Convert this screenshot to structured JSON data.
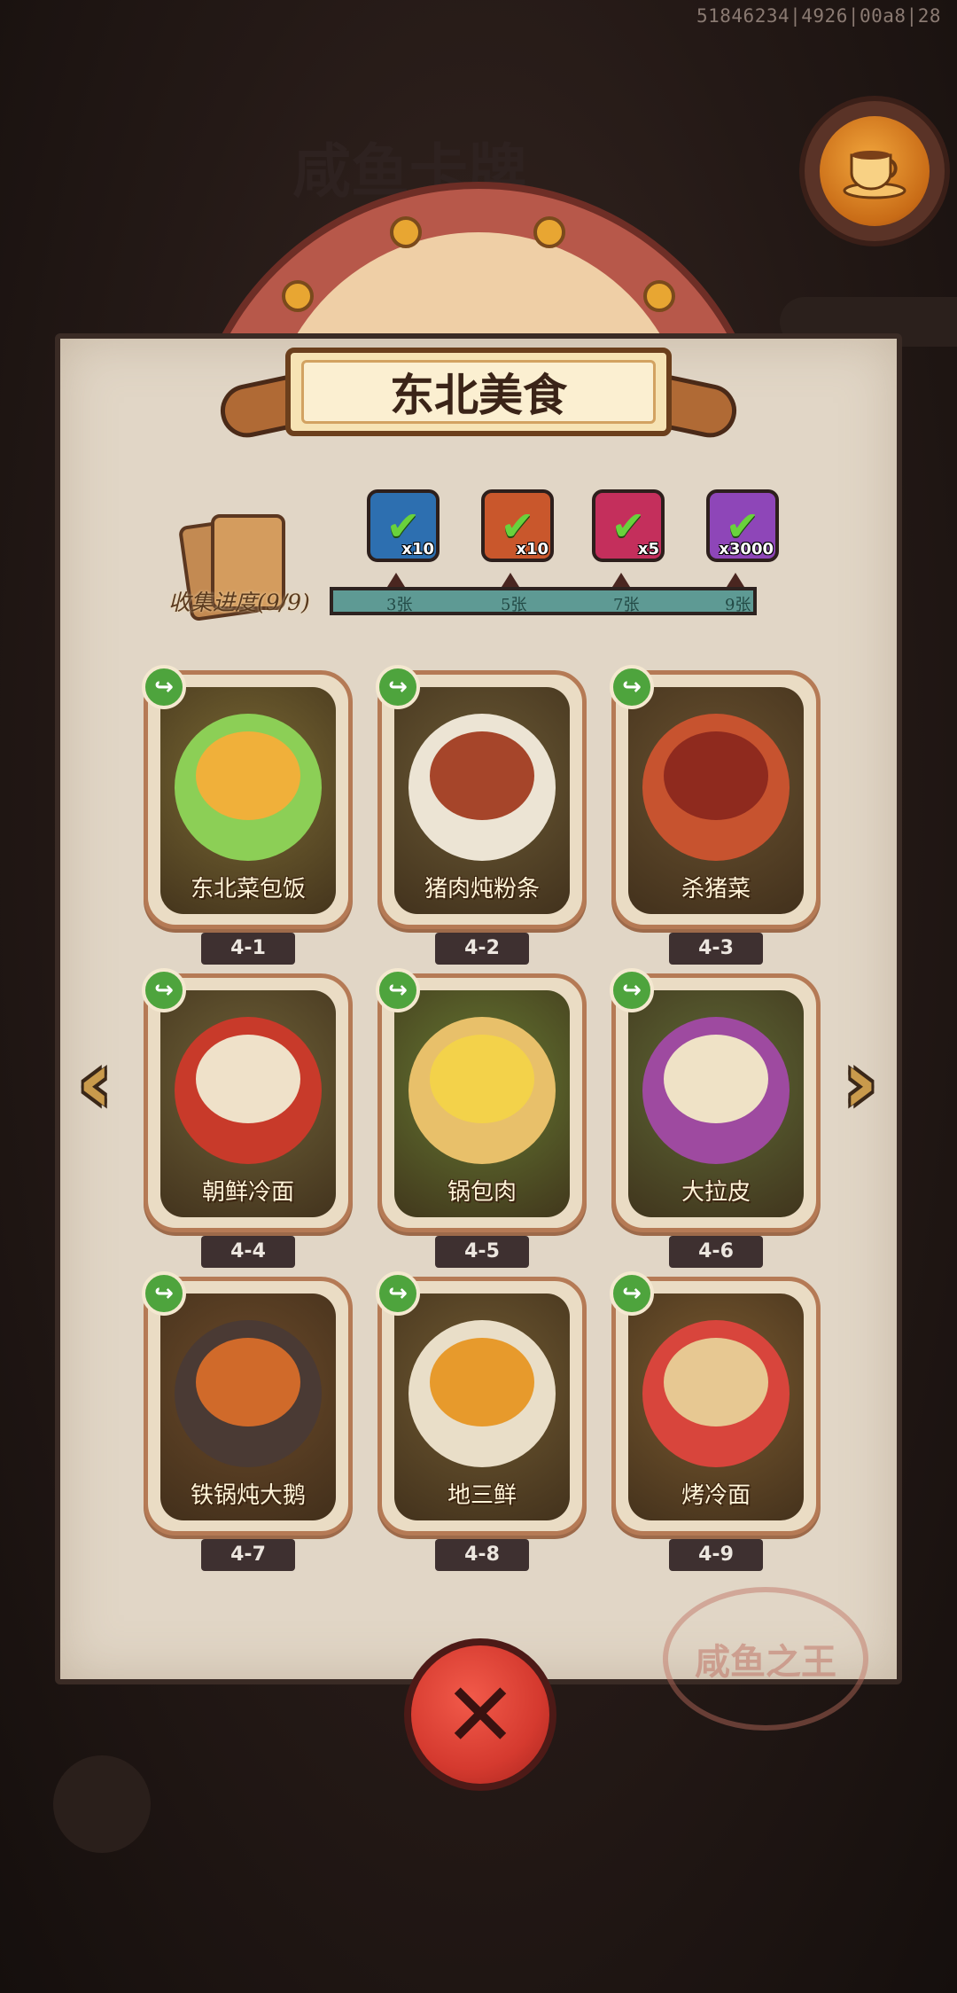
{
  "debug_id": "51846234|4926|00a8|28",
  "background_title": "咸鱼卡牌",
  "stamp_text": "咸鱼之王",
  "page_title": "东北美食",
  "collection": {
    "label": "收集进度(9/9)",
    "progress_fraction": 1.0
  },
  "rewards": [
    {
      "icon": "chest-icon",
      "qty": "x10",
      "threshold": "3张",
      "claimed": true,
      "color": "#2d6fb0"
    },
    {
      "icon": "key-icon",
      "qty": "x10",
      "threshold": "5张",
      "claimed": true,
      "color": "#c9572c"
    },
    {
      "icon": "orb-icon",
      "qty": "x5",
      "threshold": "7张",
      "claimed": true,
      "color": "#c42f5c"
    },
    {
      "icon": "gem-icon",
      "qty": "x3000",
      "threshold": "9张",
      "claimed": true,
      "color": "#8e46b8"
    }
  ],
  "cards": [
    {
      "id": "4-1",
      "name": "东北菜包饭",
      "bg": "#7a6a34",
      "dish": "#8ccf56",
      "top": "#f0b03a"
    },
    {
      "id": "4-2",
      "name": "猪肉炖粉条",
      "bg": "#6b5a35",
      "dish": "#ece4d4",
      "top": "#a6452a"
    },
    {
      "id": "4-3",
      "name": "杀猪菜",
      "bg": "#6a5230",
      "dish": "#c7532f",
      "top": "#8f2a1e"
    },
    {
      "id": "4-4",
      "name": "朝鲜冷面",
      "bg": "#6f6238",
      "dish": "#c83a2a",
      "top": "#efe1c9"
    },
    {
      "id": "4-5",
      "name": "锅包肉",
      "bg": "#667a32",
      "dish": "#e8c06a",
      "top": "#f3d24a"
    },
    {
      "id": "4-6",
      "name": "大拉皮",
      "bg": "#5f6a36",
      "dish": "#9e4aa0",
      "top": "#efe2c6"
    },
    {
      "id": "4-7",
      "name": "铁锅炖大鹅",
      "bg": "#6b4a2a",
      "dish": "#4a3a34",
      "top": "#d06a2a"
    },
    {
      "id": "4-8",
      "name": "地三鲜",
      "bg": "#705a32",
      "dish": "#e9dec8",
      "top": "#e79a2c"
    },
    {
      "id": "4-9",
      "name": "烤冷面",
      "bg": "#7a5a30",
      "dish": "#d8453c",
      "top": "#e7c892"
    }
  ],
  "nav": {
    "prev_icon": "left-arrow-icon",
    "next_icon": "right-arrow-icon"
  },
  "close_icon": "close-icon"
}
